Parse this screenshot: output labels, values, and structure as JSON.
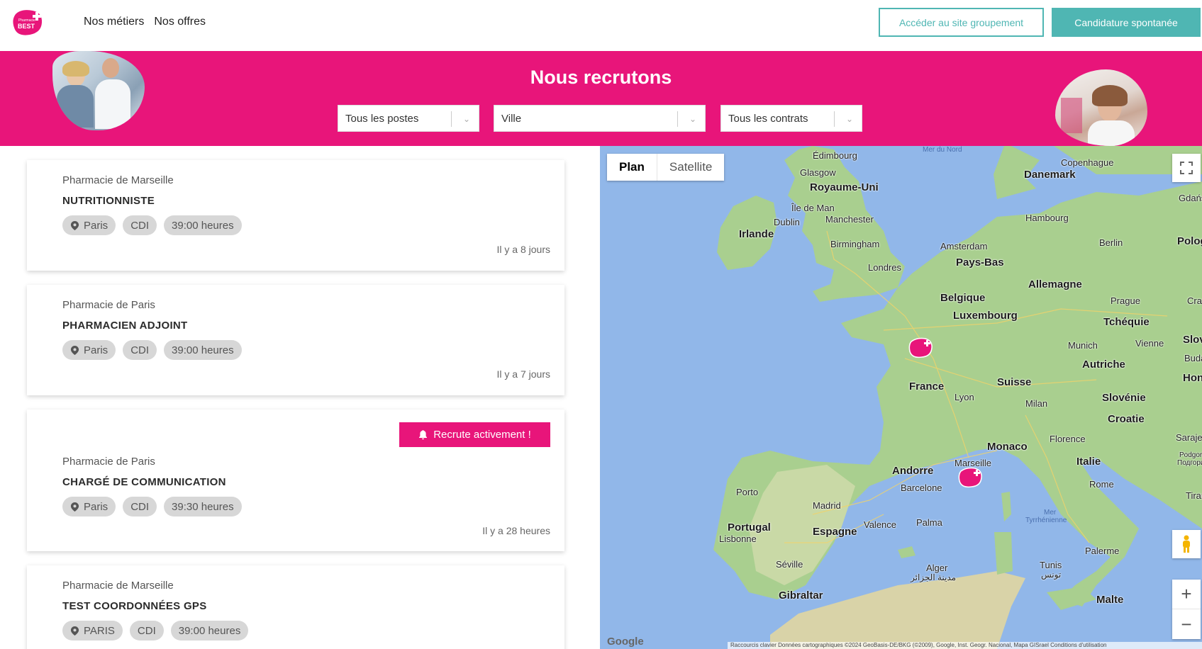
{
  "header": {
    "logo_alt": "Pharmacie BEST",
    "nav": [
      "Nos métiers",
      "Nos offres"
    ],
    "btn_site": "Accéder au site groupement",
    "btn_candidature": "Candidature spontanée",
    "colors": {
      "accent": "#e8157a",
      "teal": "#4fb6b3"
    }
  },
  "hero": {
    "title": "Nous recrutons",
    "filters": {
      "postes": "Tous les postes",
      "ville": "Ville",
      "contrats": "Tous les contrats"
    }
  },
  "jobs": [
    {
      "company": "Pharmacie de Marseille",
      "title": "NUTRITIONNISTE",
      "city": "Paris",
      "contract": "CDI",
      "hours": "39:00 heures",
      "posted": "Il y a 8 jours",
      "badge": ""
    },
    {
      "company": "Pharmacie de Paris",
      "title": "PHARMACIEN ADJOINT",
      "city": "Paris",
      "contract": "CDI",
      "hours": "39:00 heures",
      "posted": "Il y a 7 jours",
      "badge": ""
    },
    {
      "company": "Pharmacie de Paris",
      "title": "CHARGÉ DE COMMUNICATION",
      "city": "Paris",
      "contract": "CDI",
      "hours": "39:30 heures",
      "posted": "Il y a 28 heures",
      "badge": "Recrute activement !"
    },
    {
      "company": "Pharmacie de Marseille",
      "title": "TEST COORDONNÉES GPS",
      "city": "PARIS",
      "contract": "CDI",
      "hours": "39:00 heures",
      "posted": "",
      "badge": ""
    }
  ],
  "map": {
    "tab_plan": "Plan",
    "tab_satellite": "Satellite",
    "google": "Google",
    "attribution": "Raccourcis clavier   Données cartographiques ©2024 GeoBasis-DE/BKG (©2009), Google, Inst. Geogr. Nacional, Mapa GISrael   Conditions d'utilisation",
    "zoom_in": "+",
    "zoom_out": "−",
    "labels": {
      "mer_nord": "Mer du Nord",
      "edimbourg": "Édimbourg",
      "glasgow": "Glasgow",
      "royaume_uni": "Royaume-Uni",
      "ile_de_man": "Île de Man",
      "dublin": "Dublin",
      "irlande": "Irlande",
      "manchester": "Manchester",
      "birmingham": "Birmingham",
      "londres": "Londres",
      "copenhague": "Copenhague",
      "danemark": "Danemark",
      "gdansk": "Gdańsk",
      "hambourg": "Hambourg",
      "berlin": "Berlin",
      "pologne": "Pologn",
      "amsterdam": "Amsterdam",
      "pays_bas": "Pays-Bas",
      "allemagne": "Allemagne",
      "belgique": "Belgique",
      "luxembourg": "Luxembourg",
      "prague": "Prague",
      "cra": "Cra",
      "tcheque": "Tchéquie",
      "munich": "Munich",
      "vienne": "Vienne",
      "slova": "Slova",
      "budap": "Budap",
      "autriche": "Autriche",
      "hon": "Hon",
      "france": "France",
      "suisse": "Suisse",
      "lyon": "Lyon",
      "milan": "Milan",
      "slovenie": "Slovénie",
      "croatie": "Croatie",
      "florence": "Florence",
      "monaco": "Monaco",
      "marseille": "Marseille",
      "sarajevo": "Sarajev",
      "podgorica": "Podgorica",
      "podgorica_cyr": "Подгорица",
      "andorre": "Andorre",
      "italie": "Italie",
      "rome": "Rome",
      "barcelone": "Barcelone",
      "porto": "Porto",
      "madrid": "Madrid",
      "portugal": "Portugal",
      "lisbonne": "Lisbonne",
      "espagne": "Espagne",
      "valence": "Valence",
      "palma": "Palma",
      "mer_tyr": "Mer",
      "mer_tyr2": "Tyrrhénienne",
      "tirana": "Tiran",
      "seville": "Séville",
      "alger": "Alger",
      "alger_ar": "مدينة الجزائر",
      "tunis": "Tunis",
      "tunis_ar": "تونس",
      "palerme": "Palerme",
      "gibraltar": "Gibraltar",
      "malte": "Malte"
    }
  }
}
